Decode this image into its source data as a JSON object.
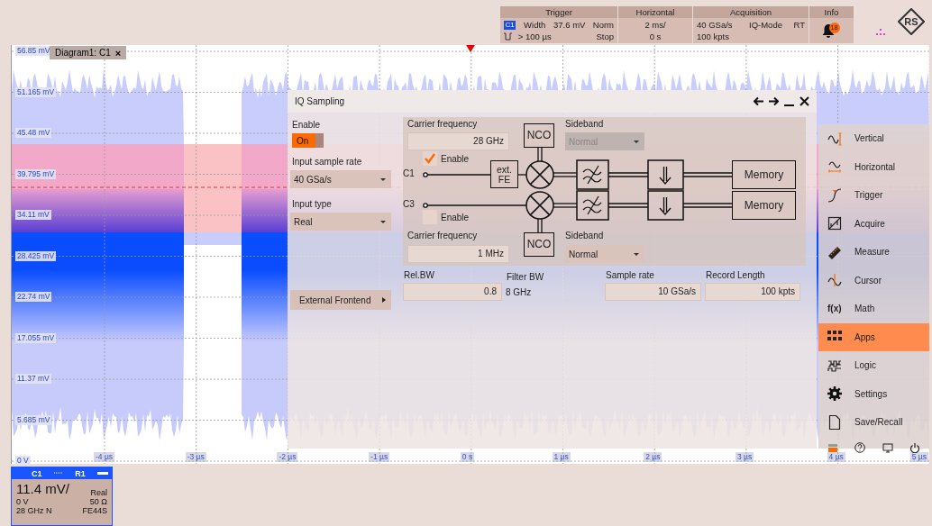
{
  "top_bar": {
    "trigger": {
      "title": "Trigger",
      "source": "C1",
      "type": "Width",
      "level": "37.6 mV",
      "mode": "Norm",
      "condition": "> 100 µs",
      "state": "Stop"
    },
    "horizontal": {
      "title": "Horizontal",
      "scale": "2 ms/",
      "position": "0 s"
    },
    "acquisition": {
      "title": "Acquisition",
      "sample_rate": "40 GSa/s",
      "mode": "IQ-Mode",
      "type": "RT",
      "record_length": "100 kpts"
    },
    "info": {
      "title": "Info",
      "count": "18"
    },
    "logo": "RS"
  },
  "diagram": {
    "tab": "Diagram1: C1",
    "close": "×",
    "y_labels": [
      "56.85 mV",
      "51.165 mV",
      "45.48 mV",
      "39.795 mV",
      "34.11 mV",
      "28.425 mV",
      "22.74 mV",
      "17.055 mV",
      "11.37 mV",
      "5.685 mV",
      "0 V"
    ],
    "x_labels": [
      "-4 µs",
      "-3 µs",
      "-2 µs",
      "-1 µs",
      "0 s",
      "1 µs",
      "2 µs",
      "3 µs",
      "4 µs",
      "5 µs"
    ]
  },
  "iq_dialog": {
    "title": "IQ Sampling",
    "enable": {
      "label": "Enable",
      "value": "On",
      "on": true
    },
    "input_sample_rate": {
      "label": "Input sample rate",
      "value": "40 GSa/s"
    },
    "input_type": {
      "label": "Input type",
      "value": "Real"
    },
    "external_frontend": "External Frontend",
    "paths": [
      {
        "input": "C1",
        "enable_label": "Enable",
        "enabled": true,
        "carrier_label": "Carrier frequency",
        "carrier": "28 GHz",
        "sideband_label": "Sideband",
        "sideband": "Normal",
        "sideband_disabled": true,
        "nco": "NCO",
        "frontend": "ext. FE",
        "memory": "Memory"
      },
      {
        "input": "C3",
        "enable_label": "Enable",
        "enabled": false,
        "carrier_label": "Carrier frequency",
        "carrier": "1 MHz",
        "sideband_label": "Sideband",
        "sideband": "Normal",
        "sideband_disabled": false,
        "nco": "NCO",
        "memory": "Memory"
      }
    ],
    "rel_bw": {
      "label": "Rel.BW",
      "value": "0.8"
    },
    "filter_bw": {
      "label": "Filter BW",
      "value": "8 GHz"
    },
    "sample_rate": {
      "label": "Sample rate",
      "value": "10 GSa/s"
    },
    "record_length": {
      "label": "Record Length",
      "value": "100 kpts"
    }
  },
  "menu": {
    "items": [
      {
        "label": "Vertical",
        "selected": false
      },
      {
        "label": "Horizontal",
        "selected": false
      },
      {
        "label": "Trigger",
        "selected": false
      },
      {
        "label": "Acquire",
        "selected": false
      },
      {
        "label": "Measure",
        "selected": false
      },
      {
        "label": "Cursor",
        "selected": false
      },
      {
        "label": "Math",
        "icon_text": "f(x)",
        "selected": false
      },
      {
        "label": "Apps",
        "selected": true
      },
      {
        "label": "Logic",
        "selected": false
      },
      {
        "label": "Settings",
        "selected": false
      },
      {
        "label": "Save/Recall",
        "selected": false
      }
    ]
  },
  "channel": {
    "name": "C1",
    "reference": "R1",
    "scale": "11.4 mV/",
    "offset": "0 V",
    "type": "Real",
    "bandwidth": "28 GHz N",
    "impedance": "50 Ω",
    "probe": "FE44S"
  }
}
